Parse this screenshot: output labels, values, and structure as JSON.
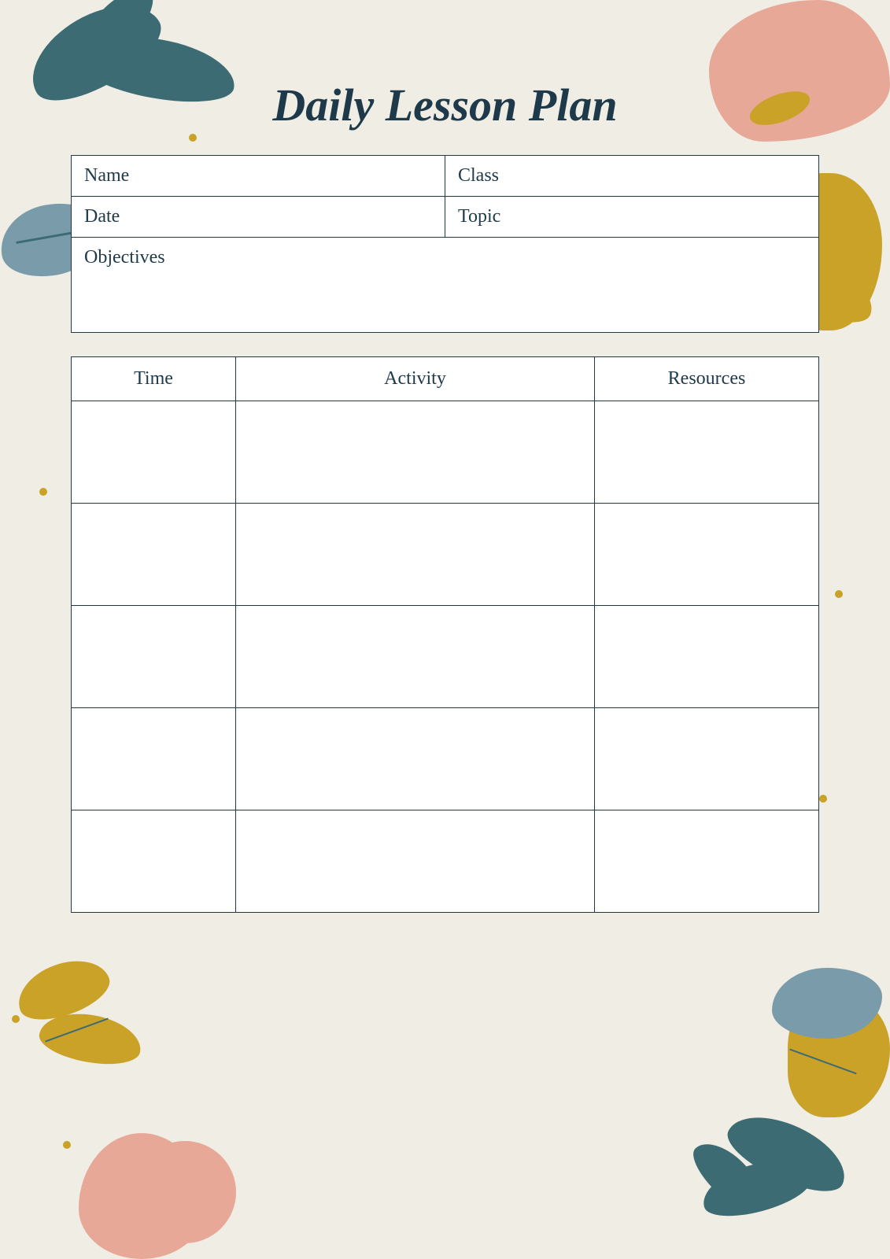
{
  "page": {
    "title": "Daily Lesson Plan",
    "form": {
      "name_label": "Name",
      "class_label": "Class",
      "date_label": "Date",
      "topic_label": "Topic",
      "objectives_label": "Objectives"
    },
    "table": {
      "headers": [
        "Time",
        "Activity",
        "Resources"
      ],
      "rows": 5
    },
    "colors": {
      "background": "#f0ede4",
      "teal": "#3d6b74",
      "gold": "#c9a227",
      "pink": "#e8a898",
      "gray_blue": "#7a9baa",
      "dark": "#1e3a4a",
      "white": "#ffffff"
    }
  }
}
